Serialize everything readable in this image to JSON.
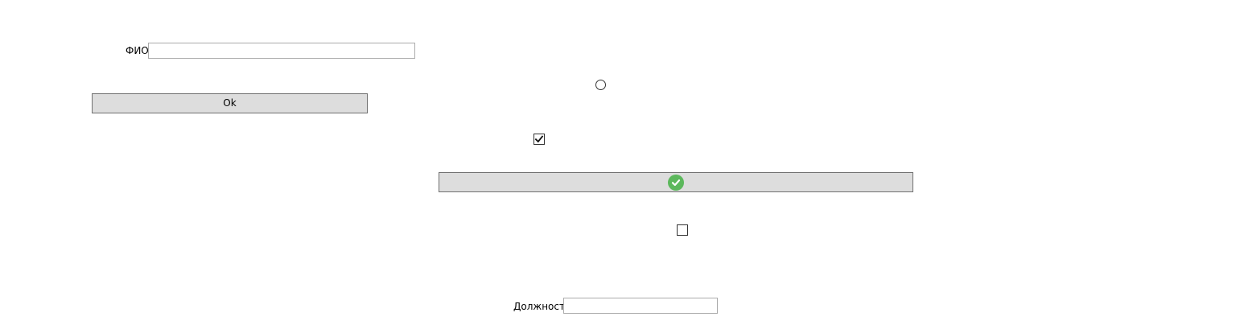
{
  "fio": {
    "label": "ФИО",
    "value": ""
  },
  "ok_button": {
    "label": "Ok"
  },
  "radio_option": {
    "checked": false
  },
  "checkbox_1": {
    "checked": true
  },
  "icon_button": {
    "icon": "check-circle-icon",
    "icon_color": "#5cb85c"
  },
  "checkbox_2": {
    "checked": false
  },
  "position": {
    "label": "Должность",
    "value": ""
  }
}
